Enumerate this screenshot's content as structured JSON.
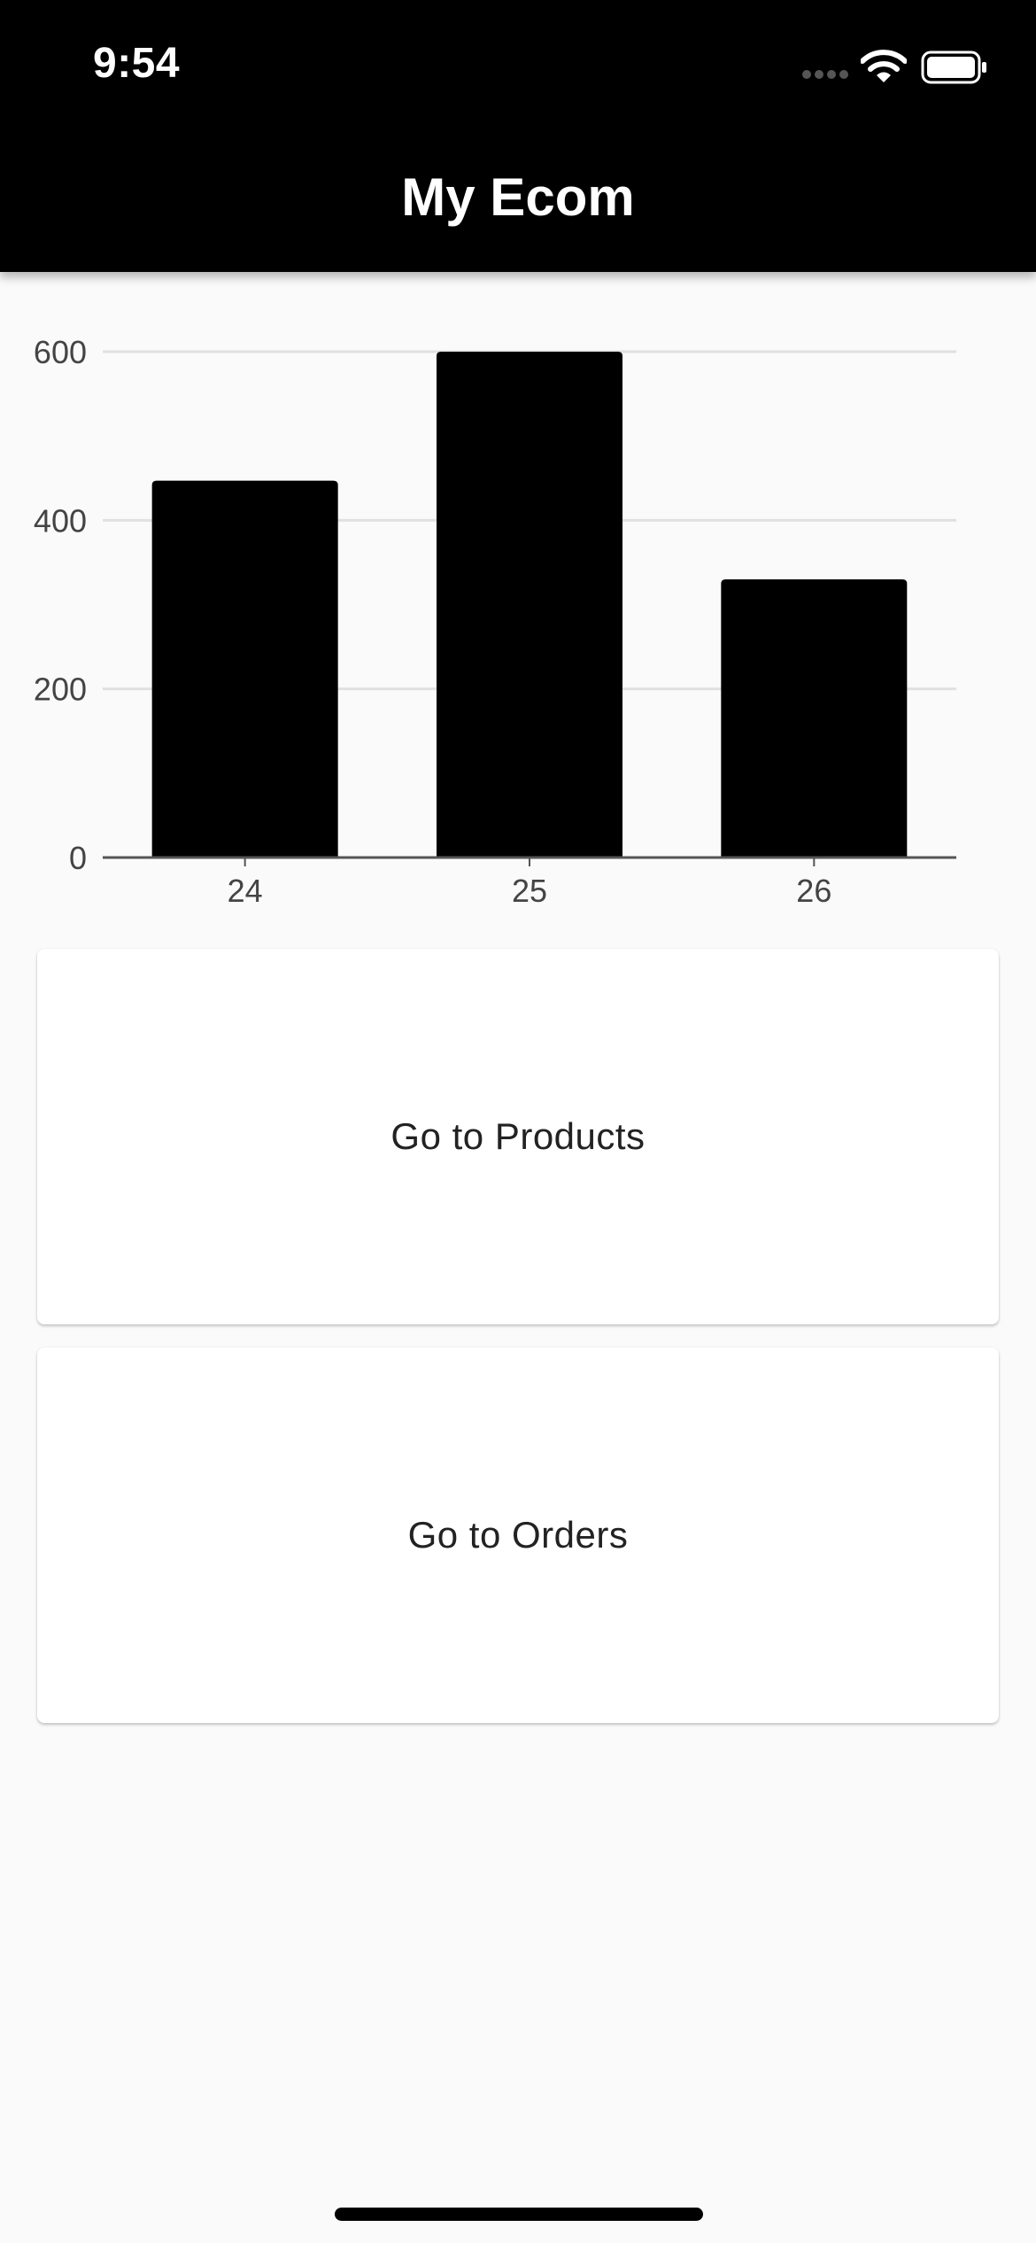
{
  "status_bar": {
    "time": "9:54",
    "icons": [
      "signal-icon",
      "wifi-icon",
      "battery-icon"
    ]
  },
  "app_bar": {
    "title": "My Ecom"
  },
  "chart_data": {
    "type": "bar",
    "categories": [
      "24",
      "25",
      "26"
    ],
    "values": [
      447,
      600,
      330
    ],
    "ylim": [
      0,
      600
    ],
    "yticks": [
      "0",
      "200",
      "400",
      "600"
    ],
    "grid": true,
    "bar_color": "#000000",
    "title": "",
    "xlabel": "",
    "ylabel": ""
  },
  "cards": {
    "products_label": "Go to Products",
    "orders_label": "Go to Orders"
  },
  "colors": {
    "app_bar": "#000000",
    "background": "#fafafa",
    "card": "#ffffff"
  }
}
